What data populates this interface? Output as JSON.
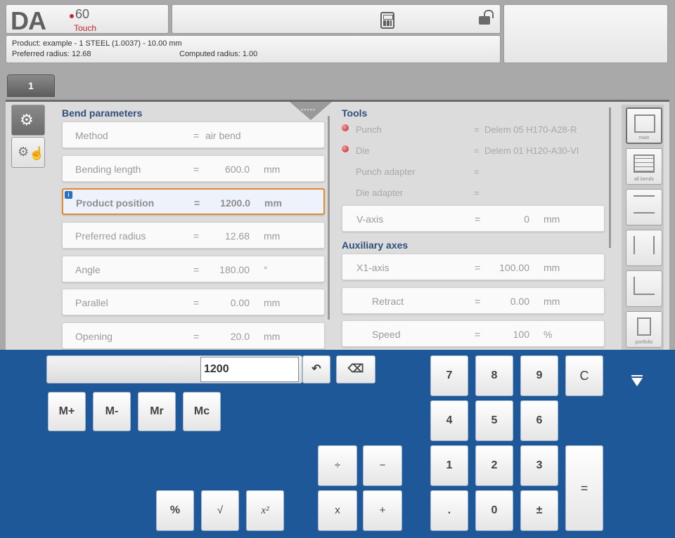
{
  "header": {
    "logo_da": "DA",
    "logo_model": "60",
    "logo_touch": "Touch",
    "product_line": "Product: example - 1 STEEL (1.0037) - 10.00 mm",
    "preferred_radius_line": "Preferred radius: 12.68",
    "computed_radius_line": "Computed radius: 1.00"
  },
  "tabs": [
    {
      "label": "1"
    }
  ],
  "bend_parameters": {
    "title": "Bend parameters",
    "rows": [
      {
        "label": "Method",
        "eq": "=",
        "value": "air bend",
        "unit": ""
      },
      {
        "label": "Bending length",
        "eq": "=",
        "value": "600.0",
        "unit": "mm"
      },
      {
        "label": "Product position",
        "eq": "=",
        "value": "1200.0",
        "unit": "mm",
        "selected": true
      },
      {
        "label": "Preferred radius",
        "eq": "=",
        "value": "12.68",
        "unit": "mm"
      },
      {
        "label": "Angle",
        "eq": "=",
        "value": "180.00",
        "unit": "°"
      },
      {
        "label": "Parallel",
        "eq": "=",
        "value": "0.00",
        "unit": "mm"
      },
      {
        "label": "Opening",
        "eq": "=",
        "value": "20.0",
        "unit": "mm"
      }
    ]
  },
  "tools": {
    "title": "Tools",
    "rows": [
      {
        "label": "Punch",
        "eq": "=",
        "value": "Delem 05 H170-A28-R"
      },
      {
        "label": "Die",
        "eq": "=",
        "value": "Delem 01 H120-A30-VI"
      },
      {
        "label": "Punch adapter",
        "eq": "=",
        "value": ""
      },
      {
        "label": "Die adapter",
        "eq": "=",
        "value": ""
      }
    ],
    "v_axis": {
      "label": "V-axis",
      "eq": "=",
      "value": "0",
      "unit": "mm"
    }
  },
  "auxiliary_axes": {
    "title": "Auxiliary axes",
    "rows": [
      {
        "label": "X1-axis",
        "eq": "=",
        "value": "100.00",
        "unit": "mm"
      },
      {
        "label": "Retract",
        "eq": "=",
        "value": "0.00",
        "unit": "mm"
      },
      {
        "label": "Speed",
        "eq": "=",
        "value": "100",
        "unit": "%"
      }
    ]
  },
  "side_views": [
    "main",
    "all bends",
    "",
    "",
    "",
    "portfolio"
  ],
  "calculator": {
    "input_value": "1200",
    "memory_keys": [
      "M+",
      "M-",
      "Mr",
      "Mc"
    ],
    "func_keys": [
      "%",
      "√",
      "x²"
    ],
    "op_keys": [
      "÷",
      "−",
      "x",
      "+"
    ],
    "digits": [
      "7",
      "8",
      "9",
      "4",
      "5",
      "6",
      "1",
      "2",
      "3",
      ".",
      "0",
      "±"
    ],
    "clear": "C",
    "equals": "=",
    "undo_icon": "undo-icon",
    "backspace_icon": "backspace-icon"
  },
  "colors": {
    "accent_blue": "#1e5898",
    "title_blue": "#2f4f7a",
    "select_orange": "#e28a2f",
    "alert_red": "#c0222a"
  }
}
